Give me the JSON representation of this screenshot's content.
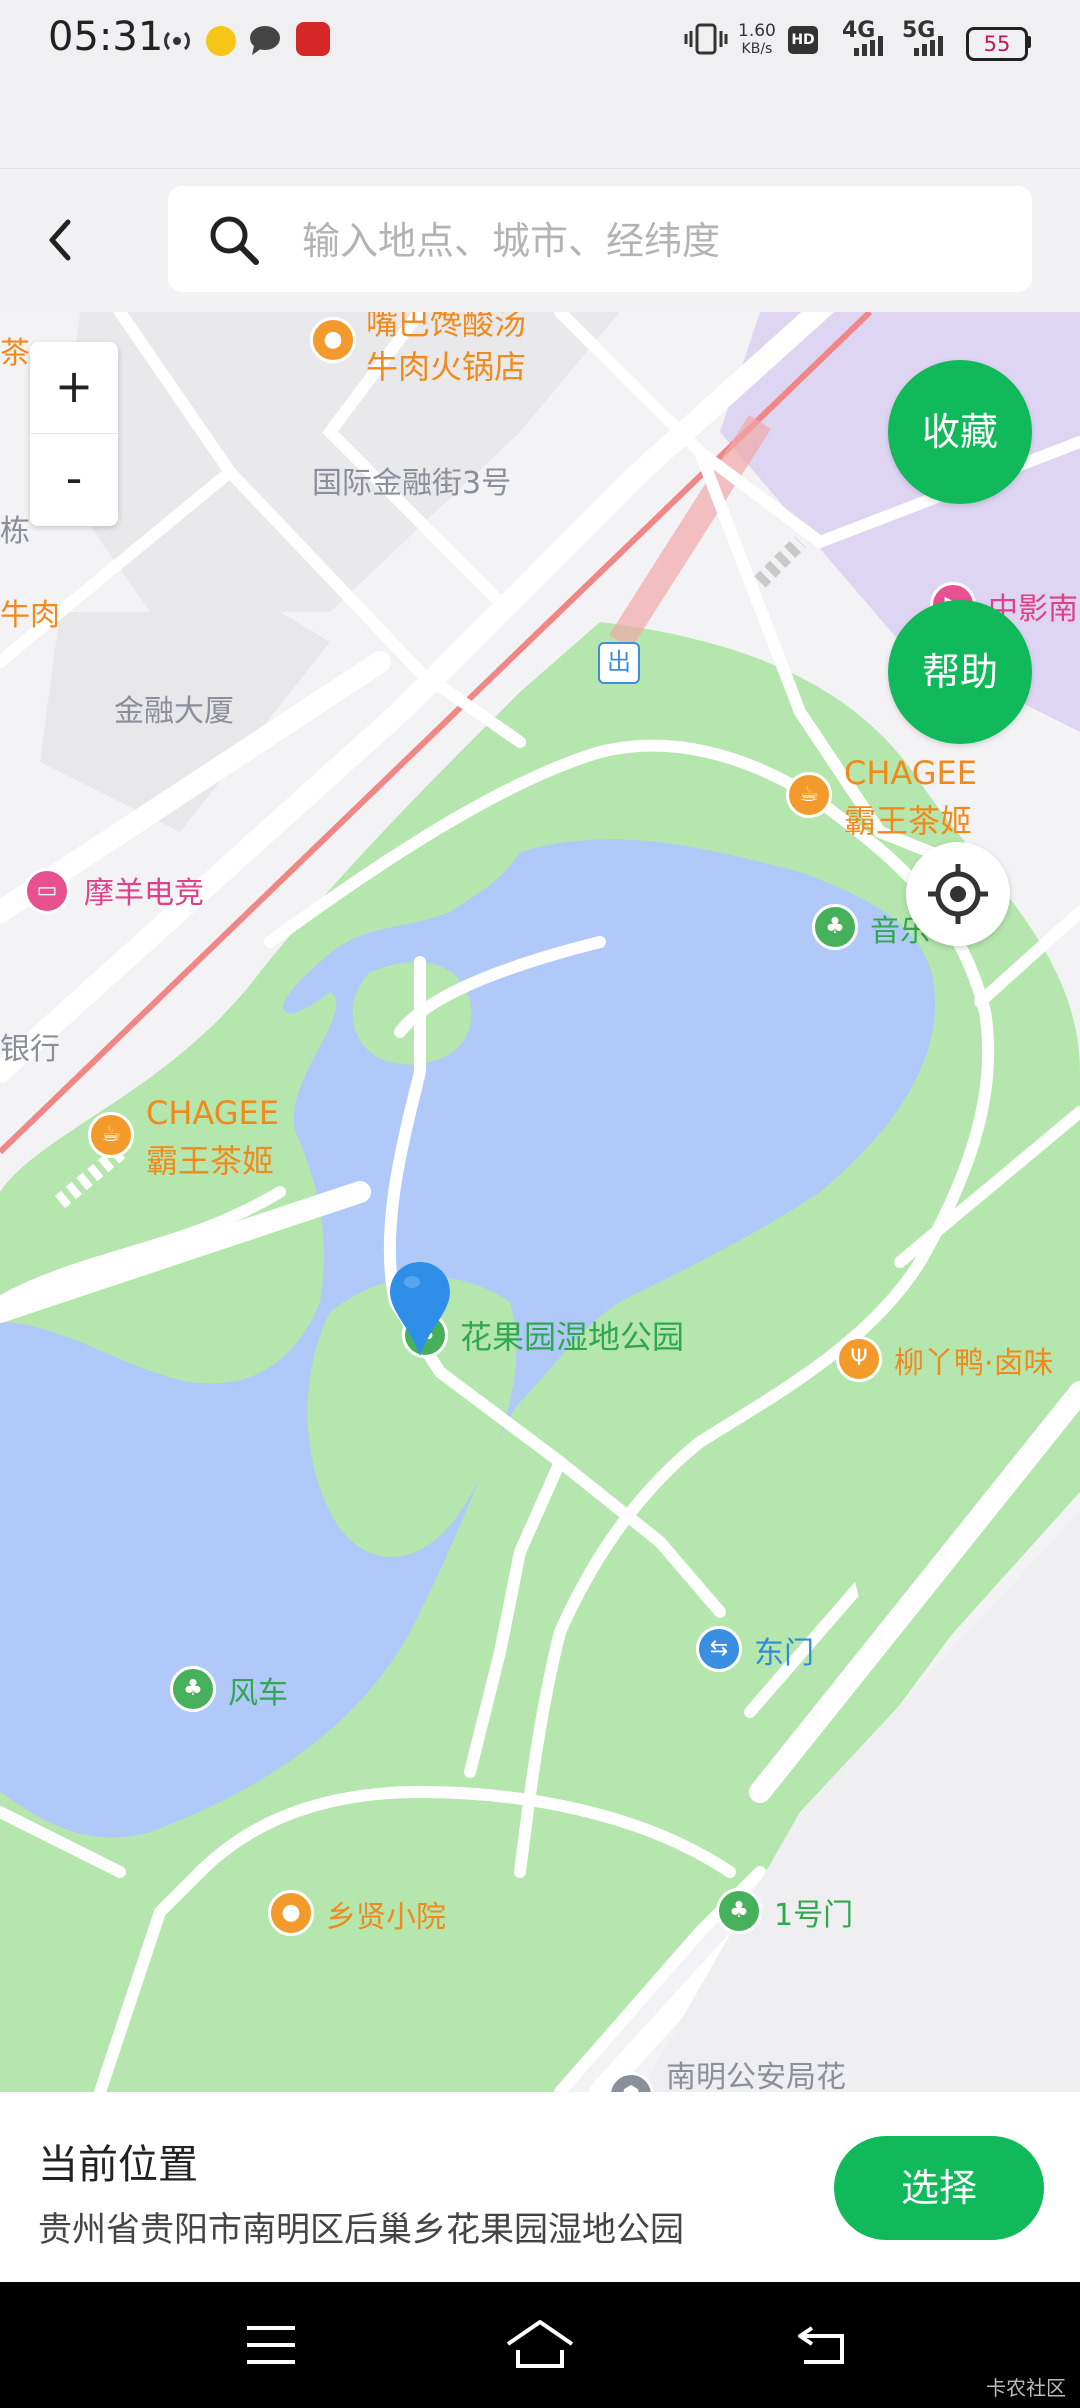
{
  "status_bar": {
    "time": "05:31",
    "net_speed_value": "1.60",
    "net_speed_unit": "KB/s",
    "hd_label": "HD",
    "network_4g": "4G",
    "network_5g": "5G",
    "battery": "55",
    "icons": [
      "hotspot-icon",
      "coin-app-icon",
      "message-icon",
      "app-notification-icon",
      "vibrate-icon",
      "signal-icon"
    ]
  },
  "header": {
    "search_placeholder": "输入地点、城市、经纬度"
  },
  "map": {
    "zoom_in": "+",
    "zoom_out": "-",
    "favorite_label": "收藏",
    "help_label": "帮助",
    "pois": {
      "mouth_soup_line1": "嘴巴馋酸汤",
      "mouth_soup_line2": "牛肉火锅店",
      "ifc3": "国际金融街3号",
      "edge_tea": "茶",
      "edge_building": "栋",
      "edge_beef": "牛肉",
      "edge_bank": "银行",
      "finance_tower": "金融大厦",
      "cinema": "中影南",
      "exit_sign": "出",
      "chagee_1_line1": "CHAGEE",
      "chagee_1_line2": "霸王茶姬",
      "moyang": "摩羊电竞",
      "music": "音乐",
      "chagee_2_line1": "CHAGEE",
      "chagee_2_line2": "霸王茶姬",
      "park": "花果园湿地公园",
      "liuyaya": "柳丫鸭·卤味",
      "east_gate": "东门",
      "windmill": "风车",
      "xiangxian": "乡贤小院",
      "gate1": "1号门",
      "police": "南明公安局花"
    }
  },
  "bottom_panel": {
    "title": "当前位置",
    "address": "贵州省贵阳市南明区后巢乡花果园湿地公园",
    "select_label": "选择"
  },
  "watermark": "卡农社区",
  "colors": {
    "accent": "#10b95a",
    "water": "#b1c9f8",
    "park": "#b5e6ad",
    "poi_orange": "#f08a1c",
    "marker": "#2f8fe8"
  }
}
